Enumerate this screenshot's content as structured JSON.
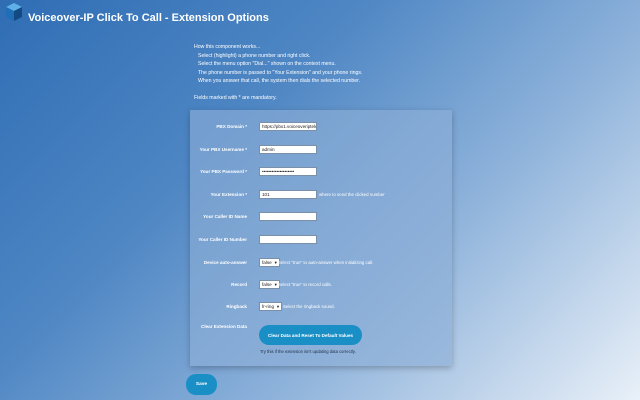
{
  "header": {
    "title": "Voiceover-IP Click To Call - Extension Options",
    "logo_icon": "cube-logo-icon"
  },
  "intro": {
    "heading": "How this component works...",
    "steps": [
      "Select (highlight) a phone number and right click.",
      "Select the menu option \"Dial...\" shown on the context menu.",
      "The phone number is passed to \"Your Extension\" and your phone rings.",
      "When you answer that call, the system then dials the selected number."
    ],
    "required_note": "Fields marked with * are mandatory."
  },
  "form": {
    "pbx_domain": {
      "label": "PBX Domain *",
      "value": "https://pbx1.voiceoveriptelecom"
    },
    "username": {
      "label": "Your PBX Username *",
      "value": "admin"
    },
    "password": {
      "label": "Your PBX Password *",
      "value": "••••••••••••••••••••"
    },
    "extension": {
      "label": "Your Extension *",
      "value": "101",
      "hint": "where to send the clicked number"
    },
    "caller_id_name": {
      "label": "Your Caller ID Name",
      "value": ""
    },
    "caller_id_number": {
      "label": "Your Caller ID Number",
      "value": ""
    },
    "auto_answer": {
      "label": "Device auto-answer",
      "value": "false",
      "hint": "Select \"true\" to auto-answer when initializing call."
    },
    "record": {
      "label": "Record",
      "value": "false",
      "hint": "Select \"true\" to record calls."
    },
    "ringback": {
      "label": "Ringback",
      "value": "fr-ring",
      "hint": "Select the ringback sound."
    },
    "clear": {
      "label": "Clear Extension Data",
      "button": "Clear Data and Reset To Default Values",
      "note": "Try this if the extension isn't updating data correctly."
    }
  },
  "save_button": "Save",
  "colors": {
    "accent": "#1a8fc6",
    "panel": "#8cafd7"
  }
}
